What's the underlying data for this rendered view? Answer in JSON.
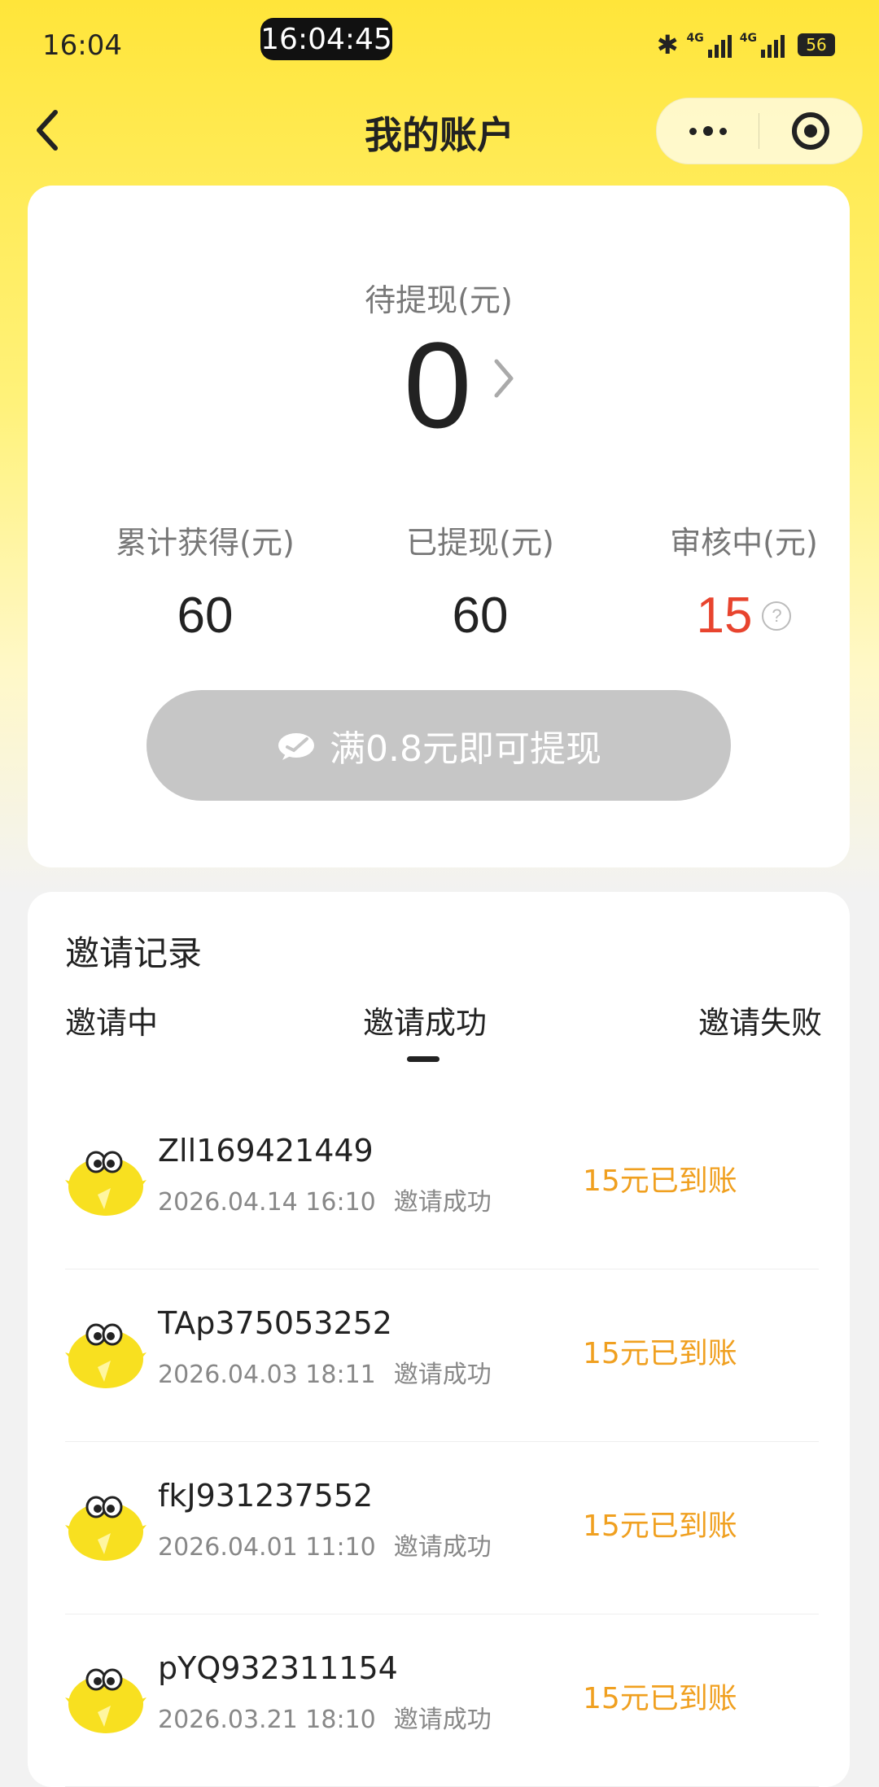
{
  "status_bar": {
    "time": "16:04",
    "clock": "16:04:45",
    "signal1": "4G",
    "signal2": "4G",
    "battery": "56"
  },
  "nav": {
    "title": "我的账户"
  },
  "account": {
    "pending_label": "待提现(元)",
    "pending_value": "0",
    "stats": [
      {
        "label": "累计获得(元)",
        "value": "60"
      },
      {
        "label": "已提现(元)",
        "value": "60"
      },
      {
        "label": "审核中(元)",
        "value": "15"
      }
    ],
    "withdraw_button": "满0.8元即可提现"
  },
  "invites": {
    "title": "邀请记录",
    "tabs": [
      "邀请中",
      "邀请成功",
      "邀请失败"
    ],
    "active_tab_index": 1,
    "records": [
      {
        "name": "Zll169421449",
        "time": "2026.04.14 16:10",
        "status": "邀请成功",
        "amount": "15元已到账"
      },
      {
        "name": "TAp375053252",
        "time": "2026.04.03 18:11",
        "status": "邀请成功",
        "amount": "15元已到账"
      },
      {
        "name": "fkJ931237552",
        "time": "2026.04.01 11:10",
        "status": "邀请成功",
        "amount": "15元已到账"
      },
      {
        "name": "pYQ932311154",
        "time": "2026.03.21 18:10",
        "status": "邀请成功",
        "amount": "15元已到账"
      }
    ]
  },
  "colors": {
    "accent_yellow": "#ffe53a",
    "review_red": "#e8442e",
    "amount_orange": "#f0a020"
  }
}
